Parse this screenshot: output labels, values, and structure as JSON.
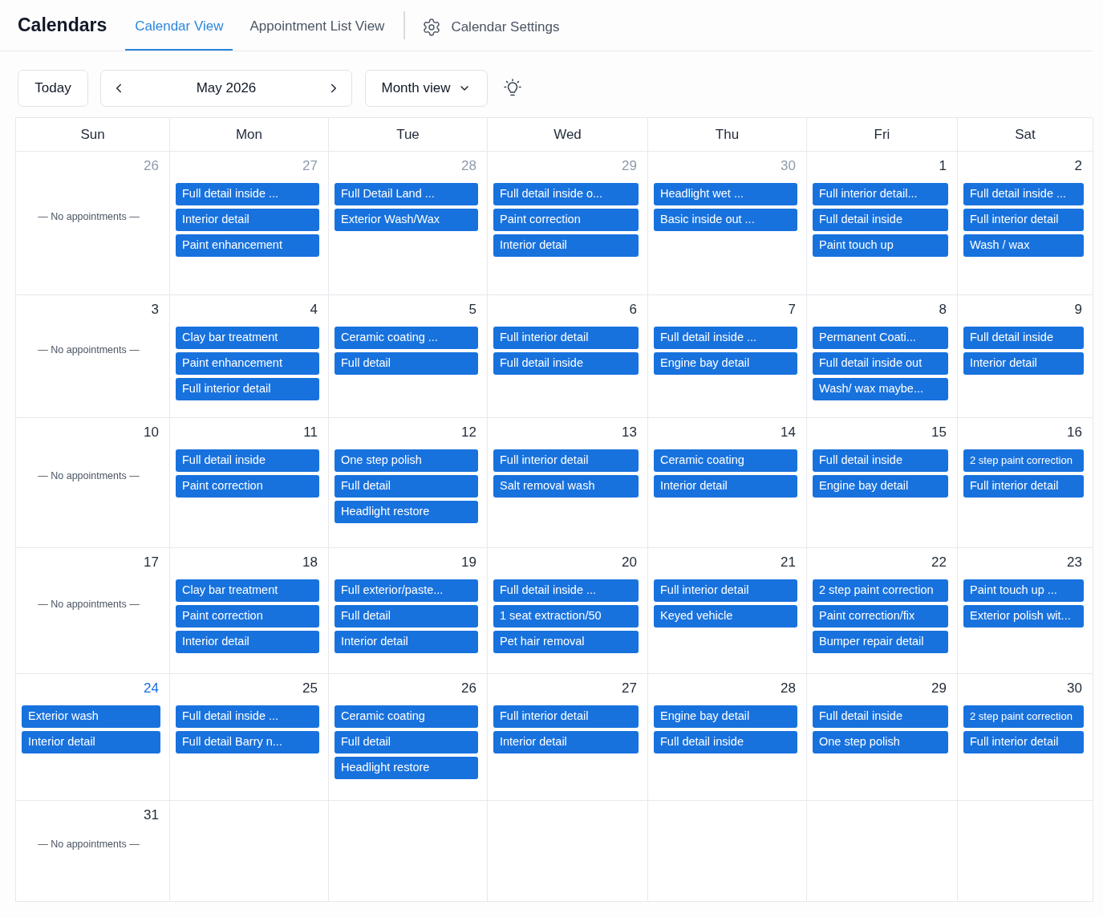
{
  "header": {
    "title": "Calendars",
    "tabs": [
      {
        "label": "Calendar View",
        "selected": true
      },
      {
        "label": "Appointment List View",
        "selected": false
      }
    ],
    "settings_link": "Calendar Settings"
  },
  "toolbar": {
    "today_button": "Today",
    "month_label": "May 2026",
    "view_select": "Month view"
  },
  "calendar": {
    "weekdays": [
      "Sun",
      "Mon",
      "Tue",
      "Wed",
      "Thu",
      "Fri",
      "Sat"
    ],
    "weeks": [
      [
        {
          "day": "26",
          "outside_month": true,
          "today": false,
          "empty_label": "— No appointments —"
        },
        {
          "day": "27",
          "outside_month": true,
          "today": false,
          "appointments": [
            "Full detail inside ...",
            "Interior detail",
            "Paint enhancement"
          ]
        },
        {
          "day": "28",
          "outside_month": true,
          "today": false,
          "appointments": [
            "Full Detail Land ...",
            "Exterior Wash/Wax"
          ]
        },
        {
          "day": "29",
          "outside_month": true,
          "today": false,
          "appointments": [
            "Full detail inside o...",
            "Paint correction",
            "Interior detail"
          ]
        },
        {
          "day": "30",
          "outside_month": true,
          "today": false,
          "appointments": [
            "Headlight wet ...",
            "Basic inside out ..."
          ]
        },
        {
          "day": "1",
          "outside_month": false,
          "today": false,
          "appointments": [
            "Full interior detail...",
            "Full detail inside",
            "Paint touch up"
          ]
        },
        {
          "day": "2",
          "outside_month": false,
          "today": false,
          "appointments": [
            "Full detail inside ...",
            "Full interior detail",
            "Wash / wax"
          ]
        }
      ],
      [
        {
          "day": "3",
          "outside_month": false,
          "today": false,
          "empty_label": "— No appointments —"
        },
        {
          "day": "4",
          "outside_month": false,
          "today": false,
          "appointments": [
            "Clay bar treatment",
            "Paint enhancement",
            "Full interior detail"
          ]
        },
        {
          "day": "5",
          "outside_month": false,
          "today": false,
          "appointments": [
            "Ceramic coating ...",
            "Full detail"
          ]
        },
        {
          "day": "6",
          "outside_month": false,
          "today": false,
          "appointments": [
            "Full interior detail",
            "Full detail inside"
          ]
        },
        {
          "day": "7",
          "outside_month": false,
          "today": false,
          "appointments": [
            "Full detail inside ...",
            "Engine bay detail"
          ]
        },
        {
          "day": "8",
          "outside_month": false,
          "today": false,
          "appointments": [
            "Permanent Coati...",
            "Full detail inside out",
            "Wash/ wax maybe..."
          ]
        },
        {
          "day": "9",
          "outside_month": false,
          "today": false,
          "appointments": [
            "Full detail inside",
            "Interior detail"
          ]
        }
      ],
      [
        {
          "day": "10",
          "outside_month": false,
          "today": false,
          "empty_label": "— No appointments —"
        },
        {
          "day": "11",
          "outside_month": false,
          "today": false,
          "appointments": [
            "Full detail inside",
            "Paint correction"
          ]
        },
        {
          "day": "12",
          "outside_month": false,
          "today": false,
          "appointments": [
            "One step polish",
            "Full detail",
            "Headlight restore"
          ]
        },
        {
          "day": "13",
          "outside_month": false,
          "today": false,
          "appointments": [
            "Full interior detail",
            "Salt removal wash"
          ]
        },
        {
          "day": "14",
          "outside_month": false,
          "today": false,
          "appointments": [
            "Ceramic coating",
            "Interior detail"
          ]
        },
        {
          "day": "15",
          "outside_month": false,
          "today": false,
          "appointments": [
            "Full detail inside",
            "Engine bay detail"
          ]
        },
        {
          "day": "16",
          "outside_month": false,
          "today": false,
          "appointments": [
            "2 step paint correction",
            "Full interior detail"
          ]
        }
      ],
      [
        {
          "day": "17",
          "outside_month": false,
          "today": false,
          "empty_label": "— No appointments —"
        },
        {
          "day": "18",
          "outside_month": false,
          "today": false,
          "appointments": [
            "Clay bar treatment",
            "Paint correction",
            "Interior detail"
          ]
        },
        {
          "day": "19",
          "outside_month": false,
          "today": false,
          "appointments": [
            "Full exterior/paste...",
            "Full detail",
            "Interior detail"
          ]
        },
        {
          "day": "20",
          "outside_month": false,
          "today": false,
          "appointments": [
            "Full detail inside ...",
            "1 seat extraction/50",
            "Pet hair removal"
          ]
        },
        {
          "day": "21",
          "outside_month": false,
          "today": false,
          "appointments": [
            "Full interior detail",
            "Keyed vehicle"
          ]
        },
        {
          "day": "22",
          "outside_month": false,
          "today": false,
          "appointments": [
            "2 step paint correction",
            "Paint correction/fix",
            "Bumper repair detail"
          ]
        },
        {
          "day": "23",
          "outside_month": false,
          "today": false,
          "appointments": [
            "Paint touch up ...",
            "Exterior polish wit..."
          ]
        }
      ],
      [
        {
          "day": "24",
          "outside_month": false,
          "today": true,
          "appointments": [
            "Exterior wash",
            "Interior detail"
          ]
        },
        {
          "day": "25",
          "outside_month": false,
          "today": false,
          "appointments": [
            "Full detail inside ...",
            "Full detail Barry n..."
          ]
        },
        {
          "day": "26",
          "outside_month": false,
          "today": false,
          "appointments": [
            "Ceramic coating",
            "Full detail",
            "Headlight restore"
          ]
        },
        {
          "day": "27",
          "outside_month": false,
          "today": false,
          "appointments": [
            "Full interior detail",
            "Interior detail"
          ]
        },
        {
          "day": "28",
          "outside_month": false,
          "today": false,
          "appointments": [
            "Engine bay detail",
            "Full detail inside"
          ]
        },
        {
          "day": "29",
          "outside_month": false,
          "today": false,
          "appointments": [
            "Full detail inside",
            "One step polish"
          ]
        },
        {
          "day": "30",
          "outside_month": false,
          "today": false,
          "appointments": [
            "2 step paint correction",
            "Full interior detail"
          ]
        }
      ],
      [
        {
          "day": "31",
          "outside_month": false,
          "today": false,
          "empty_label": "— No appointments —"
        }
      ]
    ]
  }
}
